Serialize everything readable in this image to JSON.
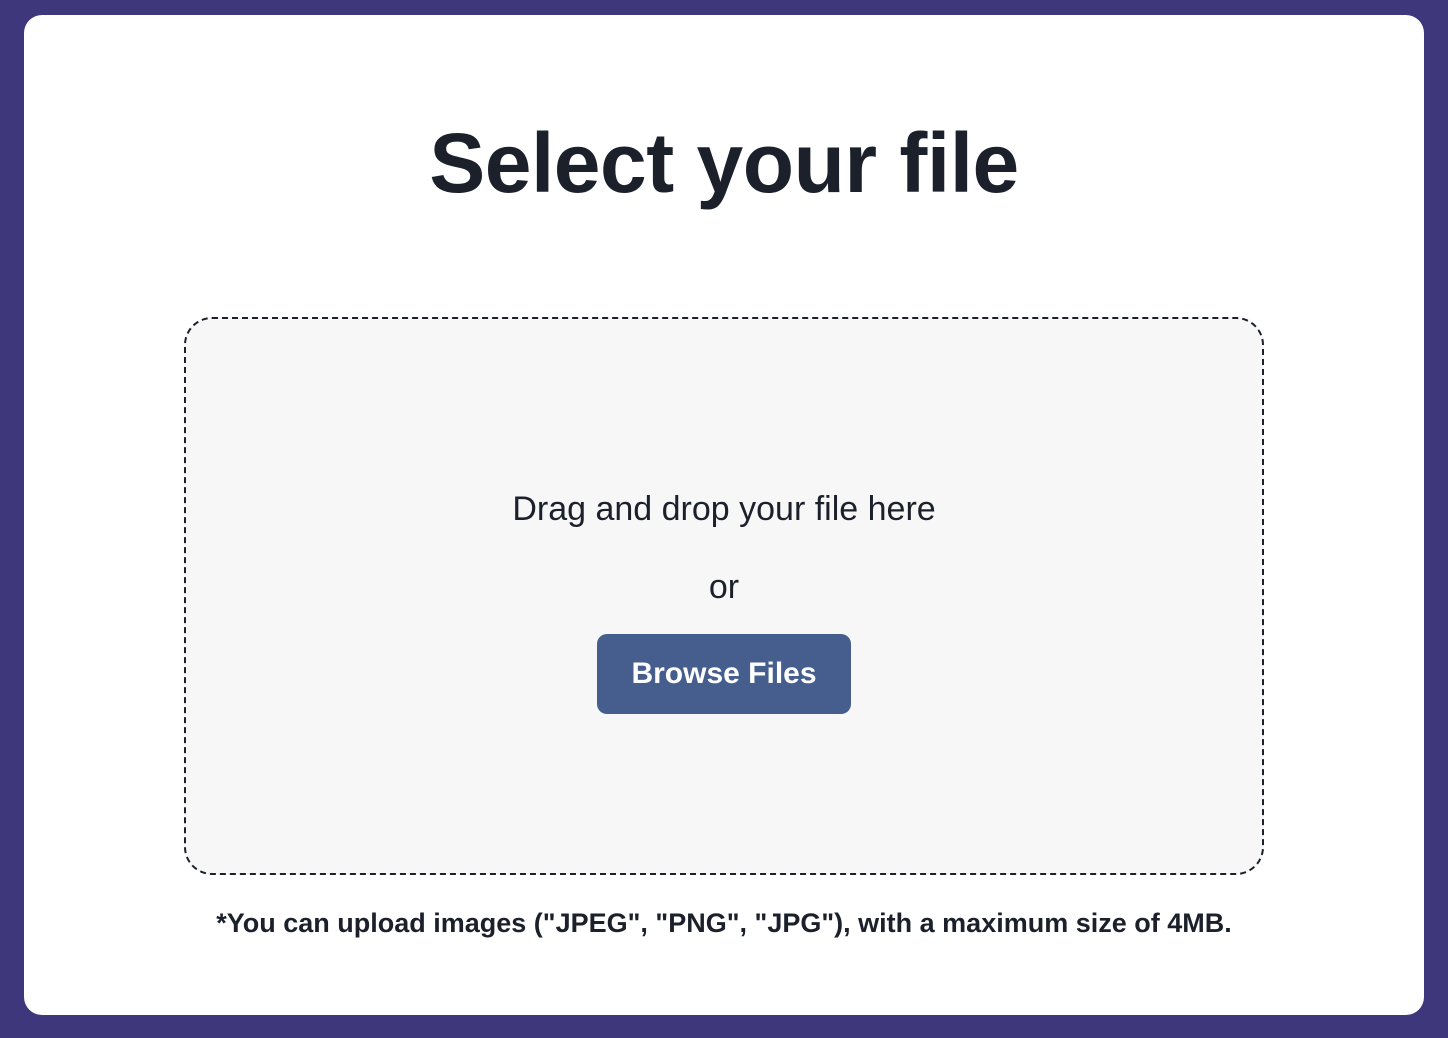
{
  "page": {
    "title": "Select your file"
  },
  "dropzone": {
    "instruction": "Drag and drop your file here",
    "separator": "or",
    "browse_label": "Browse Files"
  },
  "footer": {
    "note": "*You can upload images (\"JPEG\", \"PNG\", \"JPG\"), with a maximum size of 4MB."
  },
  "colors": {
    "background": "#3f377b",
    "card": "#ffffff",
    "dropzone_bg": "#f7f7f7",
    "text": "#1b202b",
    "button": "#455e8d",
    "button_text": "#ffffff"
  }
}
